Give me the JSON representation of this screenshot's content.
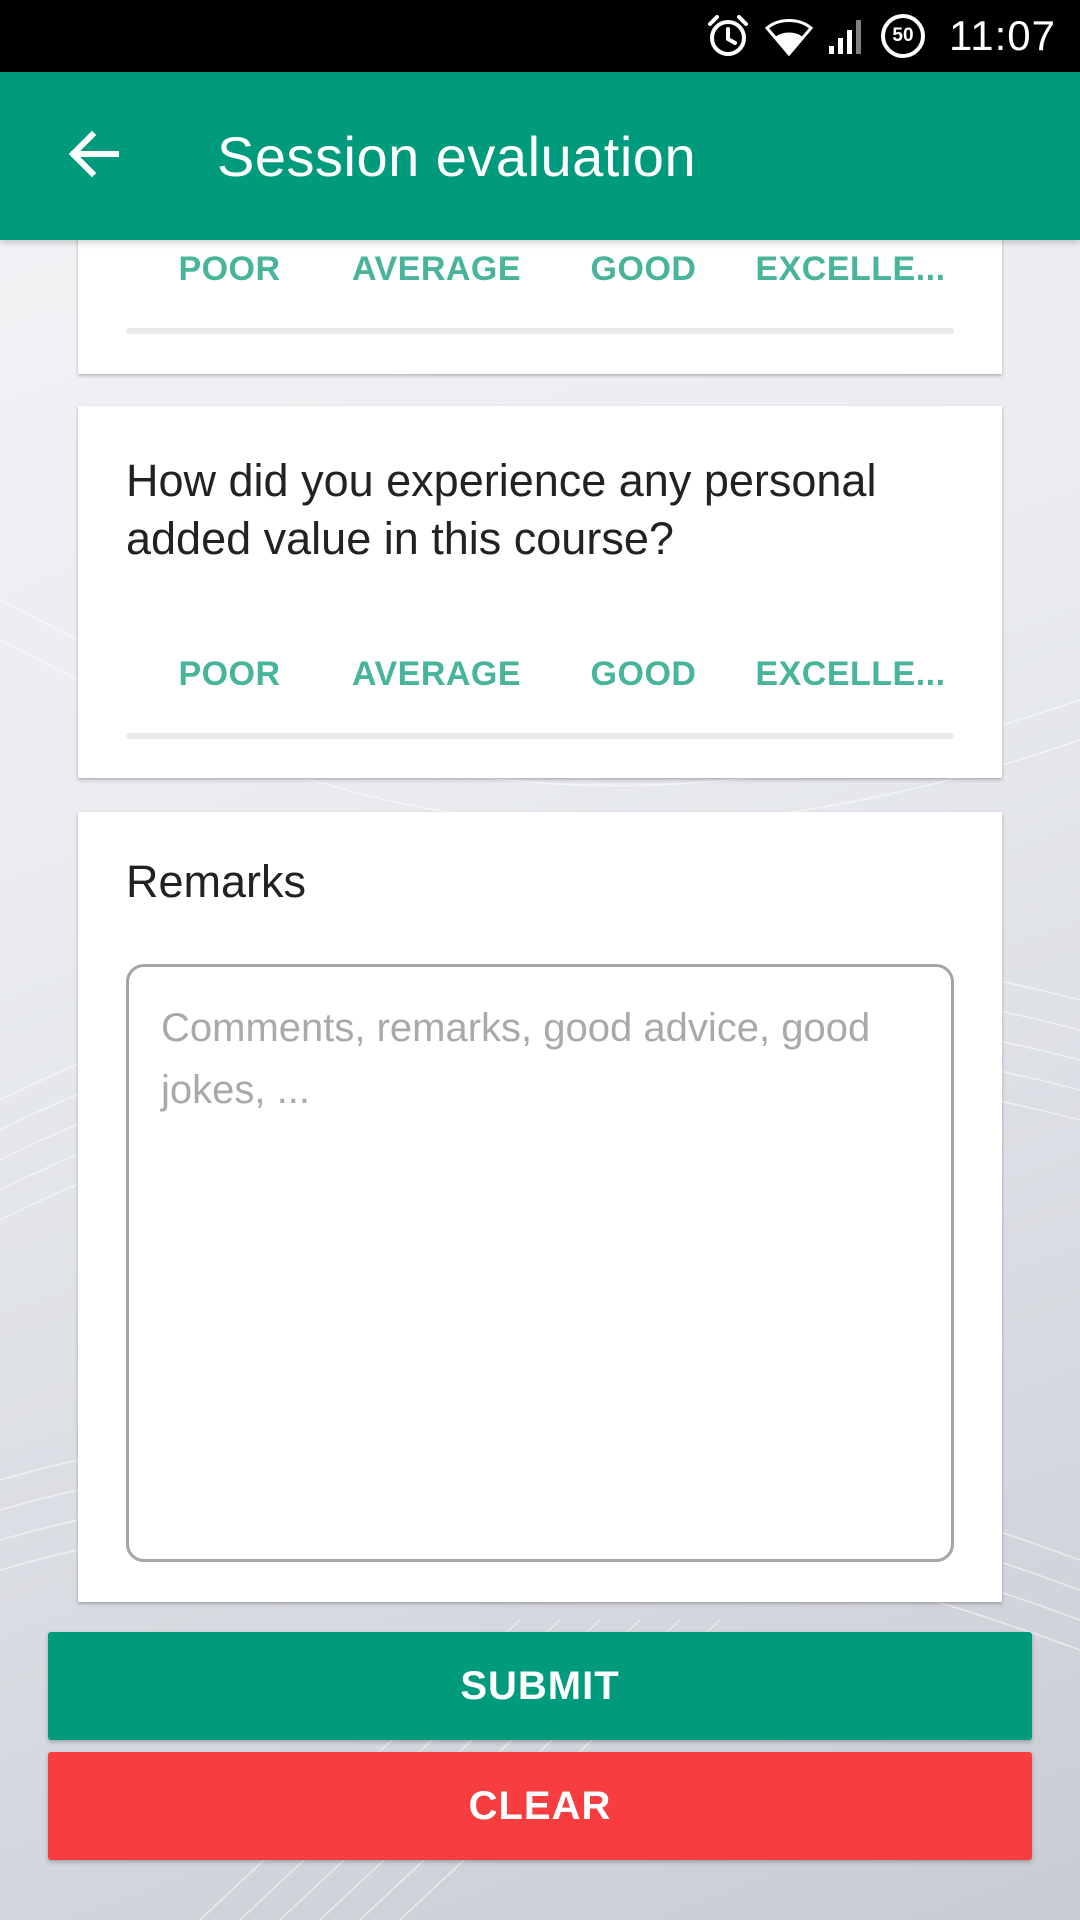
{
  "status_bar": {
    "time": "11:07",
    "battery_level": "50",
    "icons": [
      "alarm-icon",
      "wifi-icon",
      "signal-icon",
      "battery-icon"
    ]
  },
  "app_bar": {
    "title": "Session evaluation",
    "back_icon": "arrow-left-icon"
  },
  "rating_options": [
    "POOR",
    "AVERAGE",
    "GOOD",
    "EXCELLE..."
  ],
  "questions": [
    {
      "text": ""
    },
    {
      "text": "How did you experience any personal added value in this course?"
    }
  ],
  "remarks": {
    "label": "Remarks",
    "placeholder": "Comments, remarks, good advice, good jokes, ...",
    "value": ""
  },
  "actions": {
    "submit_label": "SUBMIT",
    "clear_label": "CLEAR"
  },
  "colors": {
    "primary": "#009b7d",
    "rating_text": "#47b49b",
    "danger": "#f73d40",
    "status_bar": "#000000"
  }
}
